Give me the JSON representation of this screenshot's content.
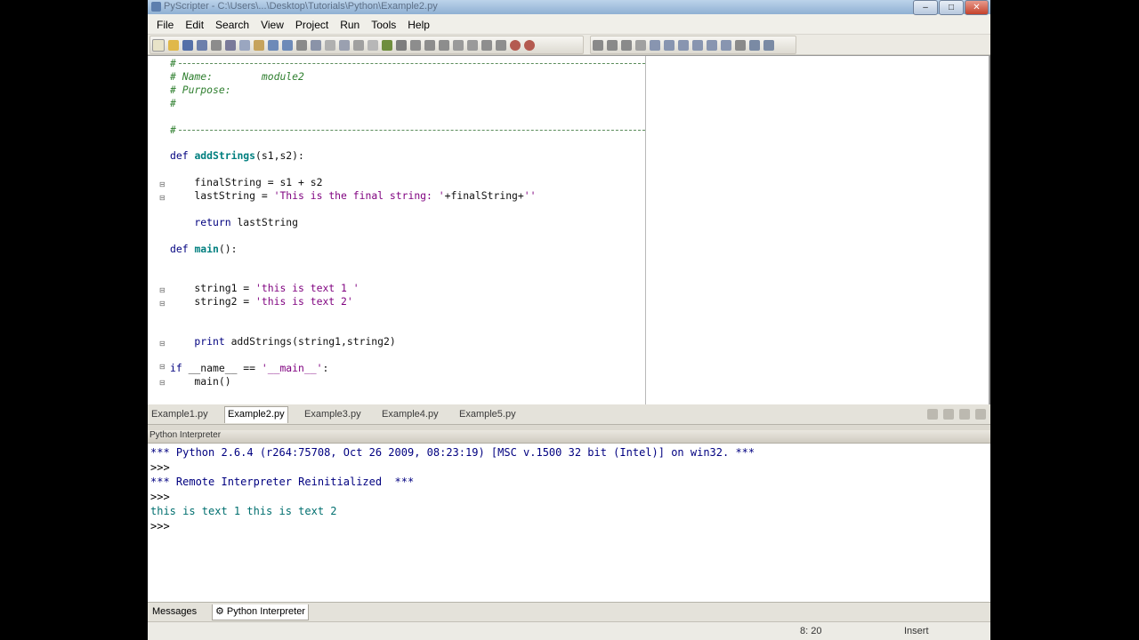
{
  "window": {
    "title": "PyScripter - C:\\Users\\...\\Desktop\\Tutorials\\Python\\Example2.py",
    "buttons": [
      "minimize",
      "maximize",
      "close"
    ]
  },
  "menu": [
    "File",
    "Edit",
    "Search",
    "View",
    "Project",
    "Run",
    "Tools",
    "Help"
  ],
  "toolbar_icons": [
    "new-file-icon",
    "open-icon",
    "save-icon",
    "save-all-icon",
    "print-icon",
    "cut-icon",
    "copy-icon",
    "paste-icon",
    "undo-icon",
    "redo-icon",
    "find-icon",
    "replace-icon",
    "run-icon",
    "debug-icon",
    "step-icon",
    "stop-icon",
    "indent-icon",
    "comment-icon",
    "layout-icon"
  ],
  "editor": {
    "separator_text": "#-------------------------------------------------------------------------------",
    "header": [
      "# Name:        module2",
      "# Purpose:",
      "#"
    ],
    "code": {
      "def1_kw": "def ",
      "def1_name": "addStrings",
      "def1_args": "(s1,s2):",
      "l_final": "    finalString = s1 + s2",
      "l_last_a": "    lastString = ",
      "l_last_str": "'This is the final string: '",
      "l_last_b": "+finalString+",
      "l_last_str2": "''",
      "l_return_kw": "    return ",
      "l_return_val": "lastString",
      "def2_kw": "def ",
      "def2_name": "main",
      "def2_args": "():",
      "s1_a": "    string1 = ",
      "s1_str": "'this is text 1 '",
      "s2_a": "    string2 = ",
      "s2_str": "'this is text 2'",
      "print_kw": "    print ",
      "print_rest": "addStrings(string1,string2)",
      "if_kw": "if ",
      "if_a": "__name__ == ",
      "if_str": "'__main__'",
      "if_b": ":",
      "main_call": "    main()"
    }
  },
  "file_tabs": [
    "Example1.py",
    "Example2.py",
    "Example3.py",
    "Example4.py",
    "Example5.py"
  ],
  "active_tab": "Example2.py",
  "panel_title": "Python Interpreter",
  "interpreter_lines": {
    "banner": "*** Python 2.6.4 (r264:75708, Oct 26 2009, 08:23:19) [MSC v.1500 32 bit (Intel)] on win32. ***",
    "p1": ">>>",
    "reinit": "*** Remote Interpreter Reinitialized  ***",
    "p2": ">>>",
    "output": "this is text 1 this is text 2",
    "p3": ">>>"
  },
  "bottom_tabs": [
    "Messages",
    "Python Interpreter"
  ],
  "status": {
    "position": "8: 20",
    "mode": "Insert"
  }
}
